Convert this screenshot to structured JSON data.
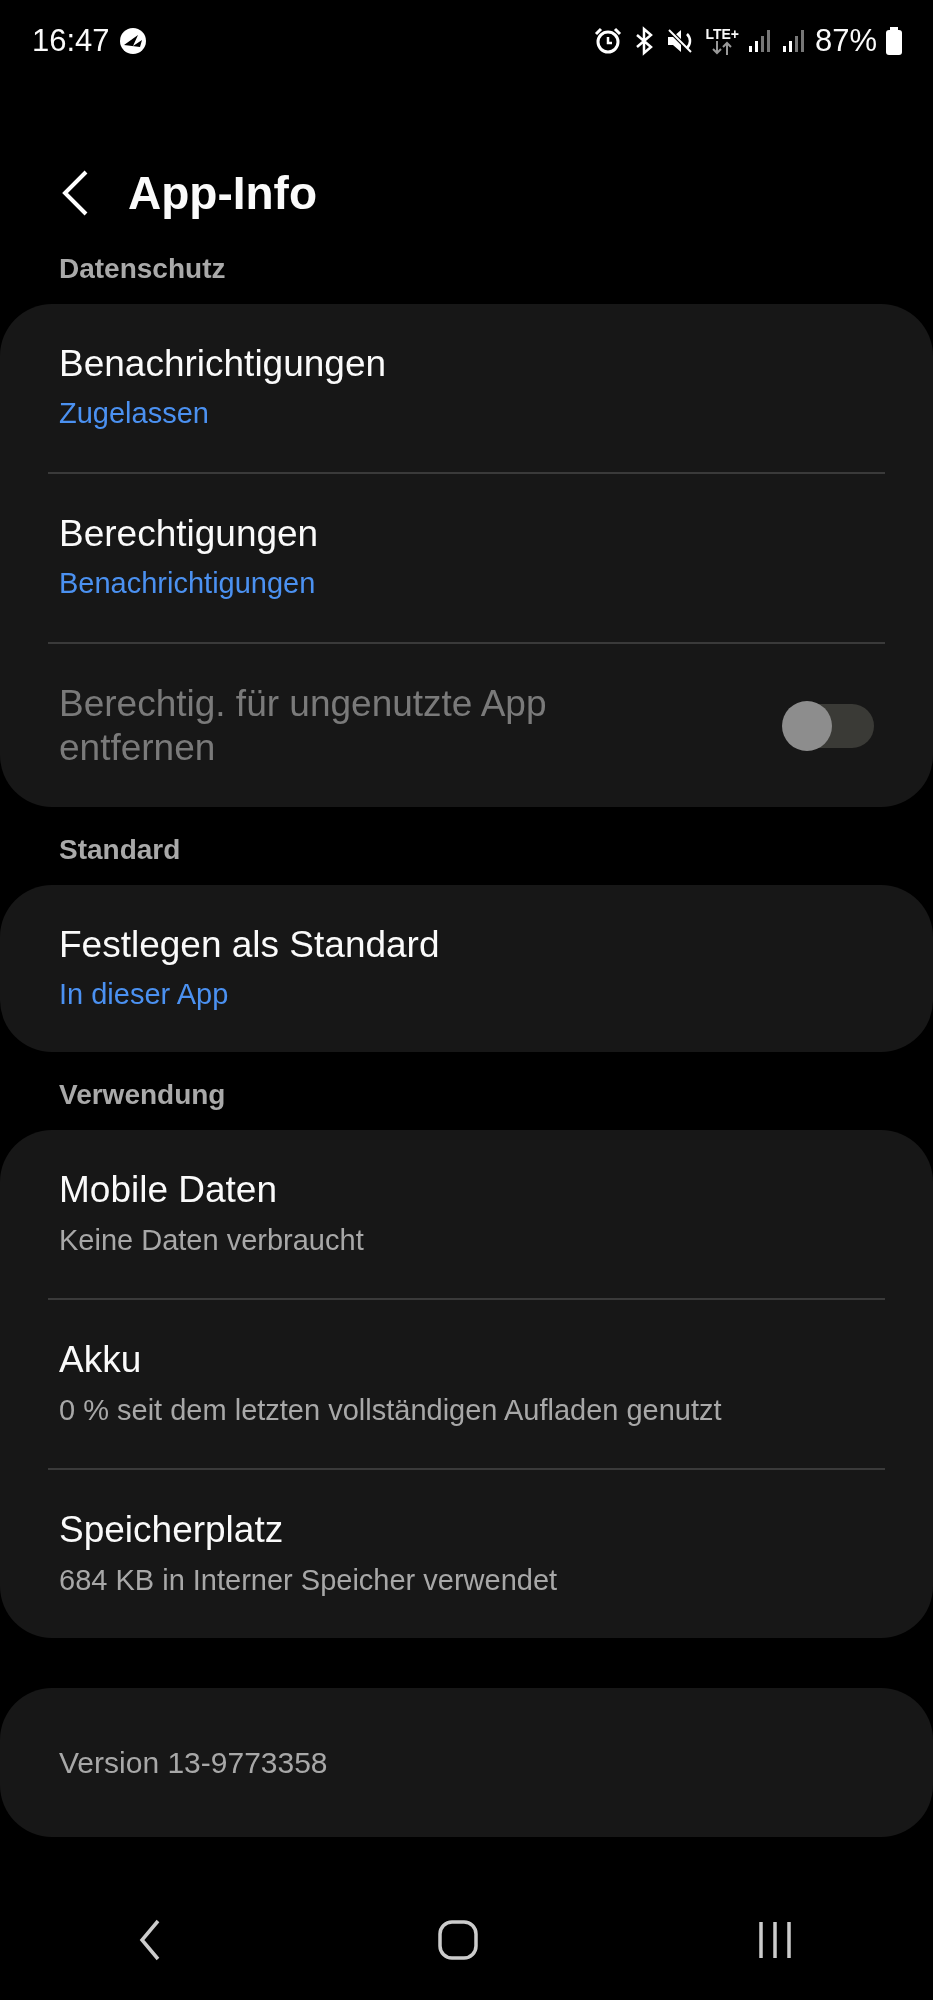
{
  "status_bar": {
    "time": "16:47",
    "network": "LTE+",
    "battery": "87%"
  },
  "header": {
    "title": "App-Info"
  },
  "sections": [
    {
      "title": "Datenschutz",
      "items": [
        {
          "kind": "link",
          "title": "Benachrichtigungen",
          "subtitle": "Zugelassen",
          "accent": true
        },
        {
          "kind": "link",
          "title": "Berechtigungen",
          "subtitle": "Benachrichtigungen",
          "accent": true
        },
        {
          "kind": "toggle",
          "title": "Berechtig. für ungenutzte App entfernen",
          "disabled": true,
          "on": false
        }
      ]
    },
    {
      "title": "Standard",
      "items": [
        {
          "kind": "link",
          "title": "Festlegen als Standard",
          "subtitle": "In dieser App",
          "accent": true
        }
      ]
    },
    {
      "title": "Verwendung",
      "items": [
        {
          "kind": "link",
          "title": "Mobile Daten",
          "subtitle": "Keine Daten verbraucht",
          "accent": false
        },
        {
          "kind": "link",
          "title": "Akku",
          "subtitle": "0 % seit dem letzten vollständigen Aufladen genutzt",
          "accent": false
        },
        {
          "kind": "link",
          "title": "Speicherplatz",
          "subtitle": "684 KB in Interner Speicher verwendet",
          "accent": false
        }
      ]
    }
  ],
  "version": "Version 13-9773358"
}
